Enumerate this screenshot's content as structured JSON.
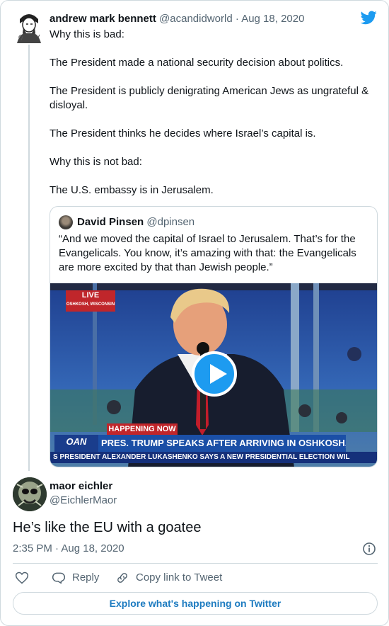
{
  "parent_tweet": {
    "display_name": "andrew mark bennett",
    "handle": "@acandidworld",
    "separator": "·",
    "date": "Aug 18, 2020",
    "avatar_icon": "sketch-portrait-avatar",
    "paragraphs": [
      "Why this is bad:",
      "The President made a national security decision about politics.",
      "The President is publicly denigrating American Jews as ungrateful & disloyal.",
      "The President thinks he decides where Israel’s capital is.",
      "Why this is not bad:",
      "The U.S. embassy is in Jerusalem."
    ]
  },
  "quoted_tweet": {
    "display_name": "David Pinsen",
    "handle": "@dpinsen",
    "text": "“And we moved the capital of Israel to Jerusalem. That’s for the Evangelicals. You know, it’s amazing with that: the Evangelicals are more excited by that than Jewish people.”",
    "video": {
      "live_label": "LIVE",
      "location_label": "OSHKOSH, WISCONSIN",
      "happening_now": "HAPPENING NOW",
      "network_logo": "OAN",
      "headline": "PRES. TRUMP SPEAKS AFTER ARRIVING IN OSHKOSH, WISC.",
      "ticker": "S PRESIDENT ALEXANDER LUKASHENKO SAYS A NEW PRESIDENTIAL ELECTION WIL"
    }
  },
  "reply_tweet": {
    "display_name": "maor eichler",
    "handle": "@EichlerMaor",
    "text": "He’s like the EU with a goatee",
    "time": "2:35 PM",
    "separator": "·",
    "date": "Aug 18, 2020"
  },
  "actions": {
    "like_icon": "heart-icon",
    "reply_label": "Reply",
    "copy_link_label": "Copy link to Tweet"
  },
  "explore_label": "Explore what's happening on Twitter",
  "colors": {
    "twitter_blue": "#1d9bf0",
    "text_primary": "#0f1419",
    "text_secondary": "#536471",
    "border": "#cfd9de",
    "link_blue": "#1d7bc0",
    "news_red": "#c0262b",
    "news_blue": "#1b4fa6"
  }
}
